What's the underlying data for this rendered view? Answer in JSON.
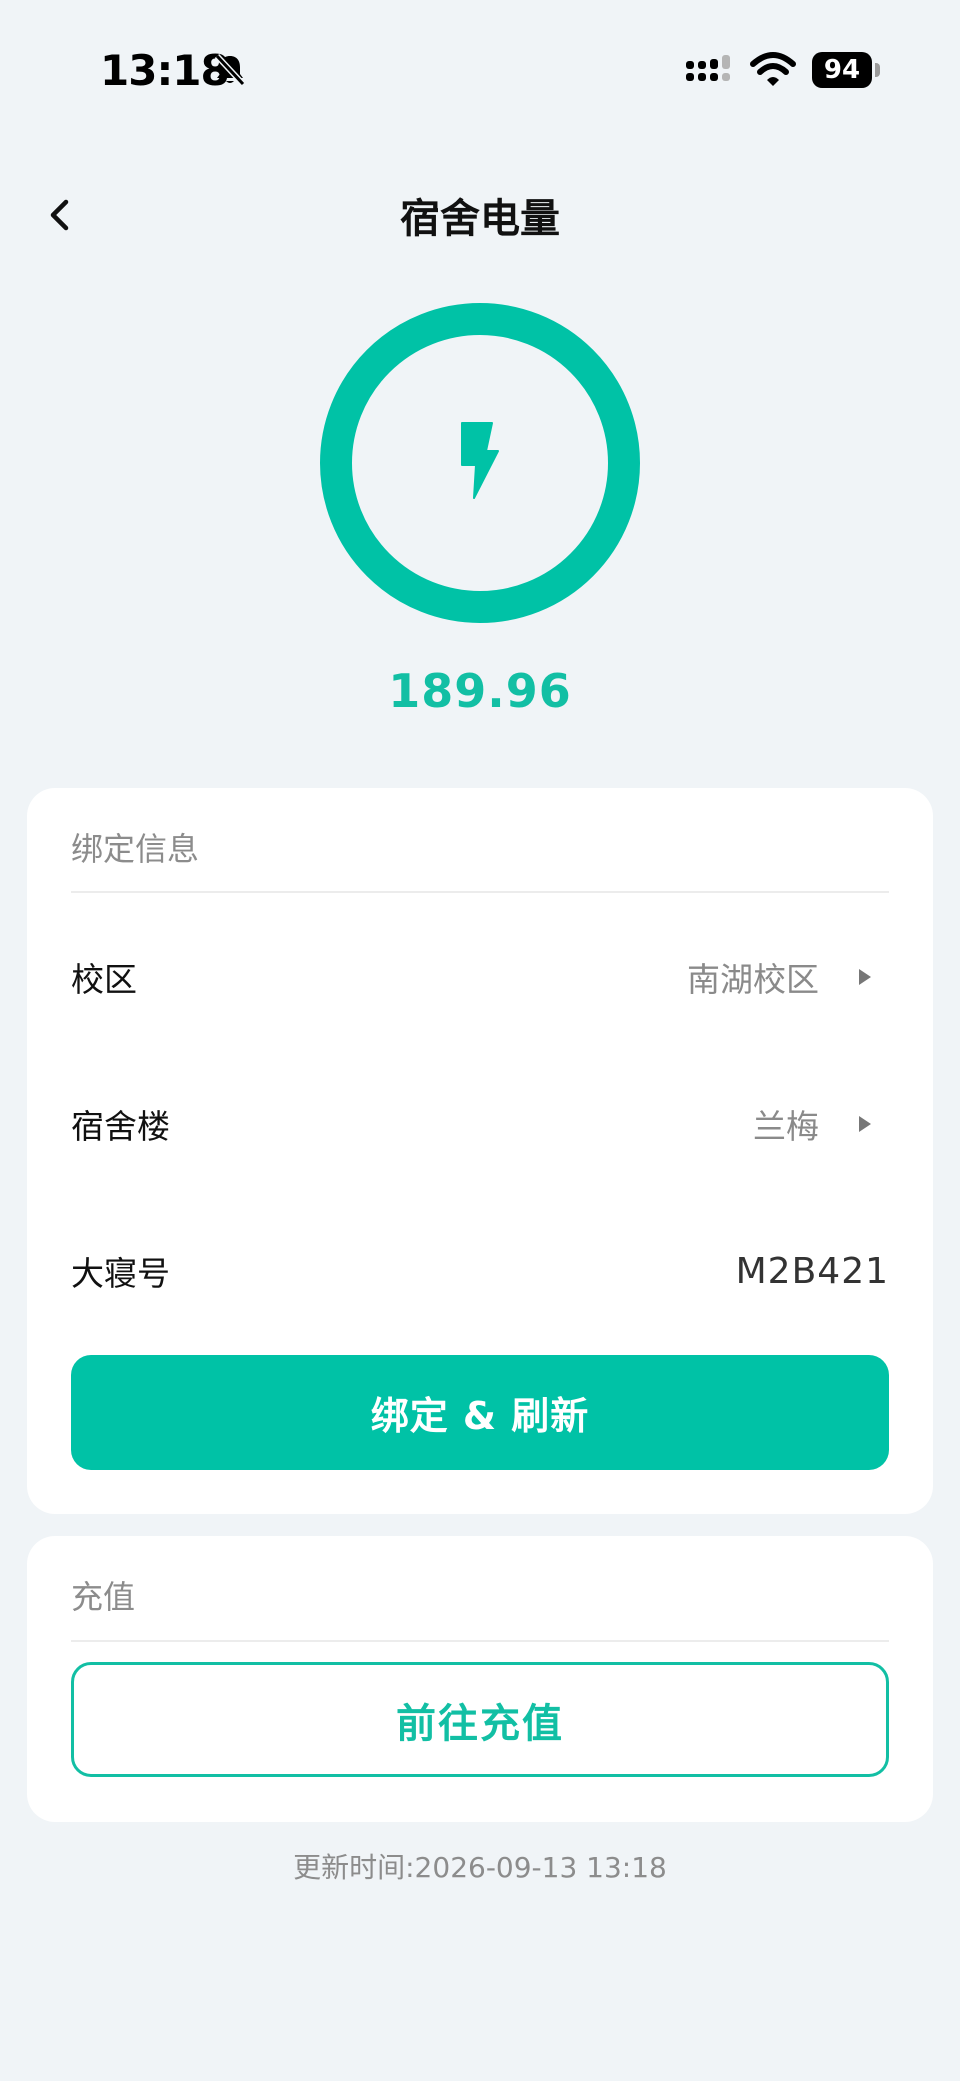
{
  "status_bar": {
    "time": "13:18",
    "battery": "94"
  },
  "header": {
    "title": "宿舍电量"
  },
  "gauge": {
    "value": "189.96"
  },
  "binding": {
    "header": "绑定信息",
    "rows": [
      {
        "label": "校区",
        "value": "南湖校区"
      },
      {
        "label": "宿舍楼",
        "value": "兰梅"
      },
      {
        "label": "大寝号",
        "value": "M2B421"
      }
    ],
    "button_label": "绑定 & 刷新"
  },
  "recharge": {
    "header": "充值",
    "button_label": "前往充值"
  },
  "footer": {
    "update_time": "更新时间:2026-09-13 13:18"
  },
  "colors": {
    "accent": "#00c2a6",
    "background": "#f0f4f7"
  },
  "icons": [
    "bell-slash-icon",
    "cellular-signal-icon",
    "wifi-icon",
    "battery-icon",
    "back-chevron-icon",
    "lightning-bolt-icon",
    "caret-right-icon"
  ]
}
